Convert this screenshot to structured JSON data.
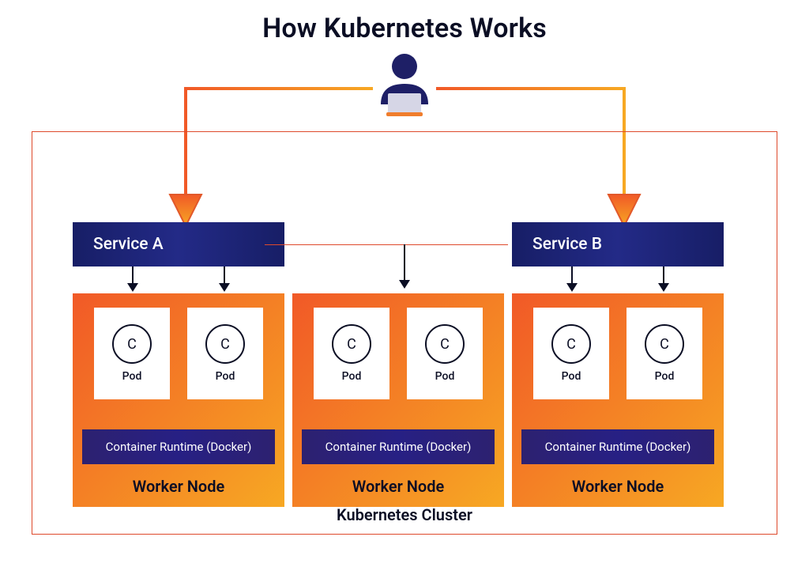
{
  "title": "How Kubernetes Works",
  "cluster_label": "Kubernetes Cluster",
  "services": {
    "a": {
      "label": "Service A"
    },
    "b": {
      "label": "Service B"
    }
  },
  "pod": {
    "circle_letter": "C",
    "label": "Pod"
  },
  "runtime_label": "Container Runtime (Docker)",
  "worker_label": "Worker Node",
  "colors": {
    "indigo": "#1e1f66",
    "orange_start": "#f15927",
    "orange_end": "#f7a823",
    "outline": "#de4a2c"
  }
}
